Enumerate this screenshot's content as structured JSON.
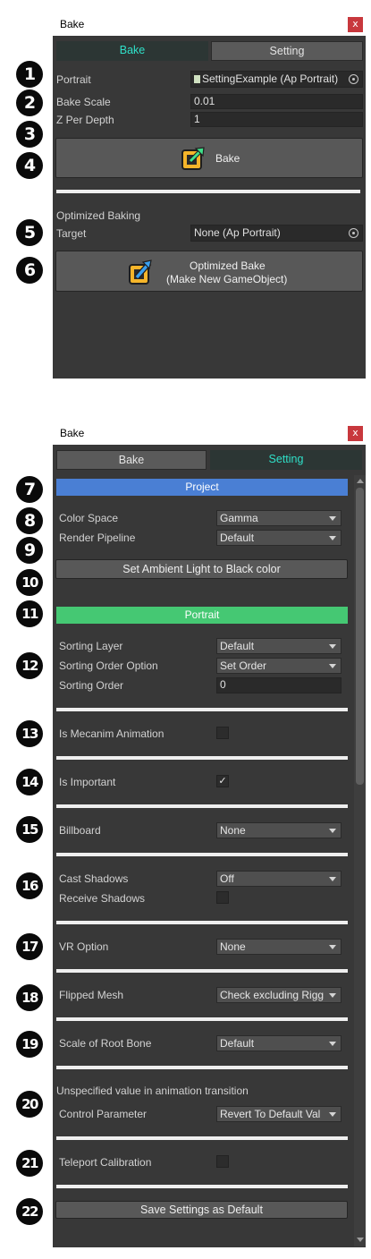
{
  "colors": {
    "tab_active_text": "#2fe0c8",
    "project_header": "#4a7fd4",
    "portrait_header": "#45c873",
    "close": "#c8383d"
  },
  "panel1": {
    "title": "Bake",
    "close": "x",
    "tabs": [
      "Bake",
      "Setting"
    ],
    "active_tab": "Bake",
    "portrait_label": "Portrait",
    "portrait_value": "SettingExample (Ap Portrait)",
    "bake_scale_label": "Bake Scale",
    "bake_scale_value": "0.01",
    "z_per_depth_label": "Z Per Depth",
    "z_per_depth_value": "1",
    "bake_button": "Bake",
    "optimized_header": "Optimized Baking",
    "target_label": "Target",
    "target_value": "None (Ap Portrait)",
    "optimized_button_line1": "Optimized Bake",
    "optimized_button_line2": "(Make New GameObject)"
  },
  "panel2": {
    "title": "Bake",
    "close": "x",
    "tabs": [
      "Bake",
      "Setting"
    ],
    "active_tab": "Setting",
    "project_header": "Project",
    "color_space_label": "Color Space",
    "color_space_value": "Gamma",
    "render_pipeline_label": "Render Pipeline",
    "render_pipeline_value": "Default",
    "ambient_button": "Set Ambient Light to Black color",
    "portrait_header": "Portrait",
    "sorting_layer_label": "Sorting Layer",
    "sorting_layer_value": "Default",
    "sorting_order_option_label": "Sorting Order Option",
    "sorting_order_option_value": "Set Order",
    "sorting_order_label": "Sorting Order",
    "sorting_order_value": "0",
    "mecanim_label": "Is Mecanim Animation",
    "mecanim_checked": false,
    "important_label": "Is Important",
    "important_checked": true,
    "billboard_label": "Billboard",
    "billboard_value": "None",
    "cast_shadows_label": "Cast Shadows",
    "cast_shadows_value": "Off",
    "receive_shadows_label": "Receive Shadows",
    "receive_shadows_checked": false,
    "vr_label": "VR Option",
    "vr_value": "None",
    "flipped_label": "Flipped Mesh",
    "flipped_value": "Check excluding Rigg",
    "root_bone_label": "Scale of Root Bone",
    "root_bone_value": "Default",
    "unspecified_header": "Unspecified value in animation transition",
    "control_param_label": "Control Parameter",
    "control_param_value": "Revert To Default Val",
    "teleport_label": "Teleport Calibration",
    "teleport_checked": false,
    "save_button": "Save Settings as Default"
  },
  "callouts": [
    "1",
    "2",
    "3",
    "4",
    "5",
    "6",
    "7",
    "8",
    "9",
    "10",
    "11",
    "12",
    "13",
    "14",
    "15",
    "16",
    "17",
    "18",
    "19",
    "20",
    "21",
    "22"
  ]
}
